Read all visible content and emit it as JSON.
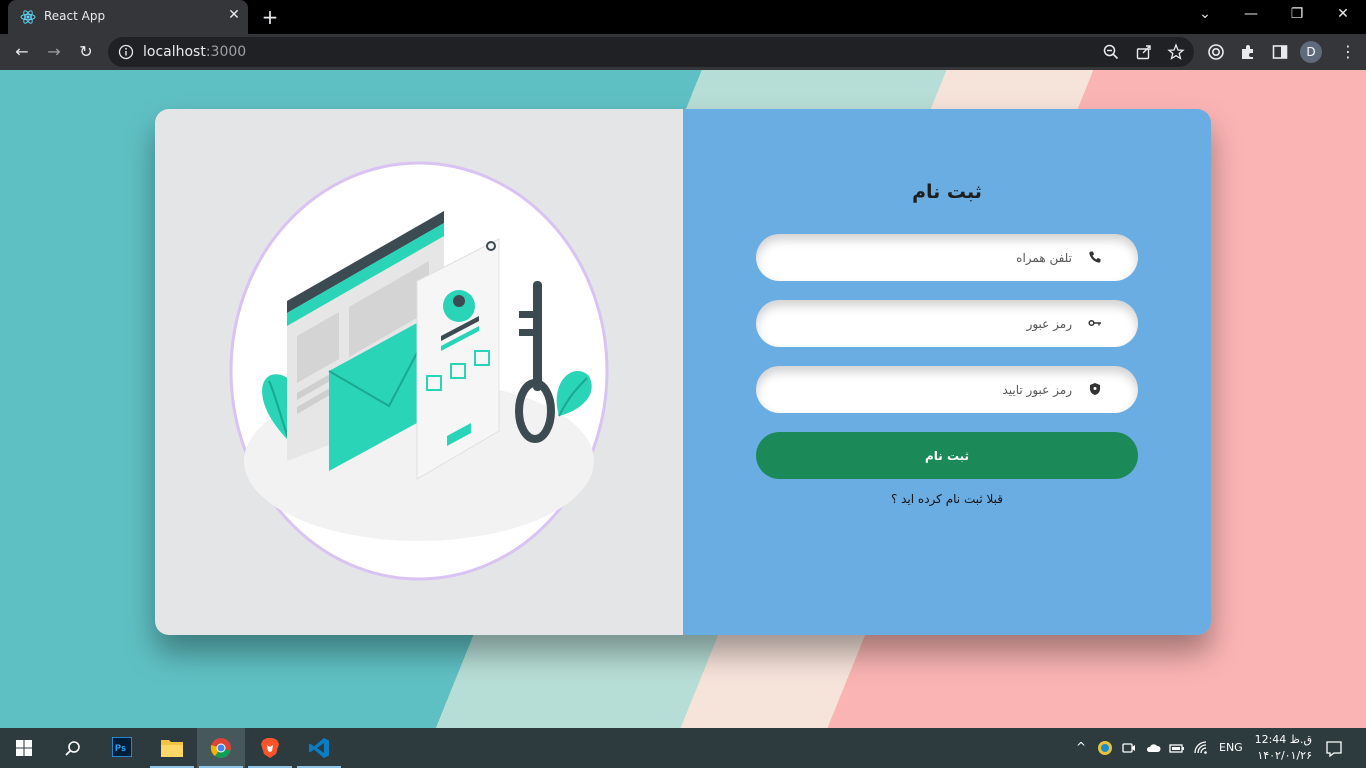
{
  "browser": {
    "tab_title": "React App",
    "tab_close": "✕",
    "new_tab": "+",
    "url_host": "localhost",
    "url_port": ":3000",
    "profile_initial": "D",
    "window_controls": {
      "minimize": "—",
      "restore": "❐",
      "close": "✕",
      "tab_search": "⌄"
    },
    "nav": {
      "back": "←",
      "forward": "→",
      "reload": "↻"
    },
    "menu": "⋮"
  },
  "signup": {
    "title": "ثبت نام",
    "phone_placeholder": "تلفن همراه",
    "password_placeholder": "رمز عبور",
    "confirm_placeholder": "رمز عبور تایید",
    "submit_label": "ثبت نام",
    "login_prompt": "قبلا ثبت نام کرده اید ؟"
  },
  "taskbar": {
    "language": "ENG",
    "time": "12:44 ق.ظ",
    "date": "۱۴۰۲/۰۱/۲۶",
    "apps": [
      "windows-start",
      "search",
      "photoshop",
      "file-explorer",
      "chrome",
      "brave",
      "vscode"
    ]
  },
  "colors": {
    "card_right": "#6aade3",
    "submit": "#1c8a58",
    "accent_teal": "#2ad4b7"
  }
}
